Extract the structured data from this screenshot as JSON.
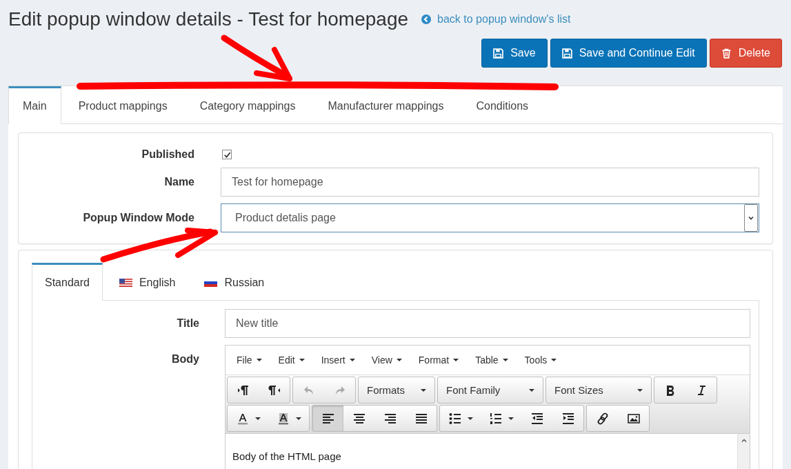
{
  "header": {
    "title": "Edit popup window details - Test for homepage",
    "back_link": "back to popup window's list"
  },
  "actions": [
    {
      "kind": "save",
      "label": "Save"
    },
    {
      "kind": "save",
      "label": "Save and Continue Edit"
    },
    {
      "kind": "delete",
      "label": "Delete"
    }
  ],
  "tabs": [
    {
      "label": "Main",
      "selected": true
    },
    {
      "label": "Product mappings",
      "selected": false
    },
    {
      "label": "Category mappings",
      "selected": false
    },
    {
      "label": "Manufacturer mappings",
      "selected": false
    },
    {
      "label": "Conditions",
      "selected": false
    }
  ],
  "form": {
    "published": {
      "label": "Published",
      "checked": true
    },
    "name": {
      "label": "Name",
      "value": "Test for homepage"
    },
    "mode": {
      "label": "Popup Window Mode",
      "value": "Product detalis page"
    }
  },
  "language_tabs": [
    {
      "label": "Standard",
      "selected": true
    },
    {
      "label": "English",
      "selected": false
    },
    {
      "label": "Russian",
      "selected": false
    }
  ],
  "content": {
    "title": {
      "label": "Title",
      "value": "New title"
    },
    "body_label": "Body",
    "menu": [
      "File",
      "Edit",
      "Insert",
      "View",
      "Format",
      "Table",
      "Tools"
    ],
    "toolbar": [
      [
        [
          {
            "kind": "ltr"
          },
          {
            "kind": "rtl"
          }
        ],
        [
          {
            "kind": "undo",
            "disabled": true
          },
          {
            "kind": "redo",
            "disabled": true
          }
        ],
        [
          {
            "kind": "select",
            "label": "Formats"
          }
        ],
        [
          {
            "kind": "select",
            "label": "Font Family"
          }
        ],
        [
          {
            "kind": "select",
            "label": "Font Sizes"
          }
        ],
        [
          {
            "kind": "bold"
          },
          {
            "kind": "italic"
          }
        ]
      ],
      [
        [
          {
            "kind": "forecolor"
          },
          {
            "kind": "backcolor"
          }
        ],
        [
          {
            "kind": "alignleft",
            "selected": true
          },
          {
            "kind": "aligncenter",
            "selected": false
          },
          {
            "kind": "alignright",
            "selected": false
          },
          {
            "kind": "justify",
            "selected": false
          }
        ],
        [
          {
            "kind": "bullist"
          },
          {
            "kind": "numlist"
          },
          {
            "kind": "outdent"
          },
          {
            "kind": "indent"
          }
        ],
        [
          {
            "kind": "link"
          },
          {
            "kind": "image"
          }
        ]
      ]
    ],
    "body_text": "Body of the HTML page"
  }
}
